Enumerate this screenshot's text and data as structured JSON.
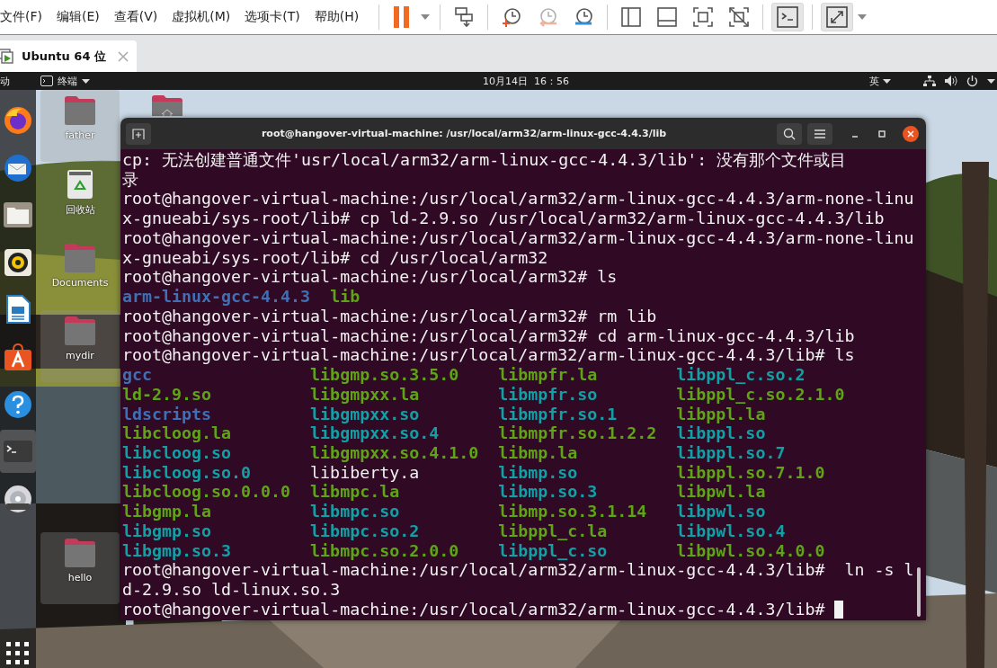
{
  "menubar": {
    "menus": [
      {
        "label": "文件(F)"
      },
      {
        "label": "编辑(E)"
      },
      {
        "label": "查看(V)"
      },
      {
        "label": "虚拟机(M)"
      },
      {
        "label": "选项卡(T)"
      },
      {
        "label": "帮助(H)"
      }
    ]
  },
  "toolbar": {
    "groups": [
      {
        "buttons": [
          {
            "kind": "pause",
            "disabled": false,
            "pressed": false
          },
          {
            "kind": "dropdown",
            "disabled": false,
            "pressed": false
          }
        ]
      },
      {
        "buttons": [
          {
            "kind": "send-keys",
            "disabled": false,
            "pressed": false
          }
        ]
      },
      {
        "buttons": [
          {
            "kind": "snapshot-take",
            "disabled": false,
            "pressed": false
          },
          {
            "kind": "snapshot-revert",
            "disabled": true,
            "pressed": false
          },
          {
            "kind": "snapshot-manage",
            "disabled": false,
            "pressed": false
          }
        ]
      },
      {
        "buttons": [
          {
            "kind": "view-library",
            "disabled": false,
            "pressed": false
          },
          {
            "kind": "view-thumbnails",
            "disabled": false,
            "pressed": false
          },
          {
            "kind": "view-fit",
            "disabled": false,
            "pressed": false
          },
          {
            "kind": "view-nofit",
            "disabled": false,
            "pressed": false
          }
        ]
      },
      {
        "buttons": [
          {
            "kind": "console",
            "disabled": false,
            "pressed": true
          }
        ]
      },
      {
        "buttons": [
          {
            "kind": "fullscreen",
            "disabled": false,
            "pressed": true
          },
          {
            "kind": "dropdown",
            "disabled": false,
            "pressed": false
          }
        ]
      }
    ]
  },
  "vm_tabs": [
    {
      "label": "Ubuntu 64 位",
      "selected": true
    }
  ],
  "top_bar": {
    "activities": "动",
    "app_menu": "终端",
    "clock": "10月14日  16：56",
    "input_method": "英"
  },
  "dock": {
    "items": [
      {
        "kind": "browser",
        "active": false
      },
      {
        "kind": "mail",
        "active": false
      },
      {
        "kind": "files",
        "active": false
      },
      {
        "kind": "music",
        "active": false
      },
      {
        "kind": "writer",
        "active": false
      },
      {
        "kind": "software",
        "active": false
      },
      {
        "kind": "help",
        "active": false
      },
      {
        "kind": "terminal",
        "active": true
      },
      {
        "kind": "disc",
        "active": false
      }
    ]
  },
  "desktop_icons": [
    {
      "kind": "folder",
      "label": "father",
      "selected": true
    },
    {
      "kind": "home-folder",
      "selected": false
    },
    {
      "kind": "trash",
      "label": "回收站",
      "selected": false
    },
    {
      "kind": "folder",
      "label": "Documents",
      "selected": false
    },
    {
      "kind": "folder",
      "label": "mydir",
      "selected": true
    },
    {
      "kind": "folder",
      "label": "hello",
      "selected": true
    }
  ],
  "terminal": {
    "title": "root@hangover-virtual-machine: /usr/local/arm32/arm-linux-gcc-4.4.3/lib",
    "lines": [
      {
        "kind": "text",
        "text": "cp: 无法创建普通文件'usr/local/arm32/arm-linux-gcc-4.4.3/lib': 没有那个文件或目"
      },
      {
        "kind": "text",
        "text": "录"
      },
      {
        "kind": "text",
        "text": "root@hangover-virtual-machine:/usr/local/arm32/arm-linux-gcc-4.4.3/arm-none-linu"
      },
      {
        "kind": "text",
        "text": "x-gnueabi/sys-root/lib# cp ld-2.9.so /usr/local/arm32/arm-linux-gcc-4.4.3/lib"
      },
      {
        "kind": "text",
        "text": "root@hangover-virtual-machine:/usr/local/arm32/arm-linux-gcc-4.4.3/arm-none-linu"
      },
      {
        "kind": "text",
        "text": "x-gnueabi/sys-root/lib# cd /usr/local/arm32"
      },
      {
        "kind": "text",
        "text": "root@hangover-virtual-machine:/usr/local/arm32# ls"
      },
      {
        "kind": "ls",
        "items": [
          {
            "name": "arm-linux-gcc-4.4.3",
            "kind": "dir"
          },
          {
            "name": "lib",
            "kind": "exec"
          }
        ]
      },
      {
        "kind": "text",
        "text": "root@hangover-virtual-machine:/usr/local/arm32# rm lib"
      },
      {
        "kind": "text",
        "text": "root@hangover-virtual-machine:/usr/local/arm32# cd arm-linux-gcc-4.4.3/lib"
      },
      {
        "kind": "text",
        "text": "root@hangover-virtual-machine:/usr/local/arm32/arm-linux-gcc-4.4.3/lib# ls"
      },
      {
        "kind": "ls-columns",
        "items": [
          {
            "name": "gcc",
            "kind": "dir"
          },
          {
            "name": "libgmp.so.3.5.0",
            "kind": "exec"
          },
          {
            "name": "libmpfr.la",
            "kind": "exec"
          },
          {
            "name": "libppl_c.so.2",
            "kind": "link"
          }
        ]
      },
      {
        "kind": "ls-columns",
        "items": [
          {
            "name": "ld-2.9.so",
            "kind": "exec"
          },
          {
            "name": "libgmpxx.la",
            "kind": "exec"
          },
          {
            "name": "libmpfr.so",
            "kind": "link"
          },
          {
            "name": "libppl_c.so.2.1.0",
            "kind": "exec"
          }
        ]
      },
      {
        "kind": "ls-columns",
        "items": [
          {
            "name": "ldscripts",
            "kind": "dir"
          },
          {
            "name": "libgmpxx.so",
            "kind": "link"
          },
          {
            "name": "libmpfr.so.1",
            "kind": "link"
          },
          {
            "name": "libppl.la",
            "kind": "exec"
          }
        ]
      },
      {
        "kind": "ls-columns",
        "items": [
          {
            "name": "libcloog.la",
            "kind": "exec"
          },
          {
            "name": "libgmpxx.so.4",
            "kind": "link"
          },
          {
            "name": "libmpfr.so.1.2.2",
            "kind": "exec"
          },
          {
            "name": "libppl.so",
            "kind": "link"
          }
        ]
      },
      {
        "kind": "ls-columns",
        "items": [
          {
            "name": "libcloog.so",
            "kind": "link"
          },
          {
            "name": "libgmpxx.so.4.1.0",
            "kind": "exec"
          },
          {
            "name": "libmp.la",
            "kind": "exec"
          },
          {
            "name": "libppl.so.7",
            "kind": "link"
          }
        ]
      },
      {
        "kind": "ls-columns",
        "items": [
          {
            "name": "libcloog.so.0",
            "kind": "link"
          },
          {
            "name": "libiberty.a",
            "kind": "file"
          },
          {
            "name": "libmp.so",
            "kind": "link"
          },
          {
            "name": "libppl.so.7.1.0",
            "kind": "exec"
          }
        ]
      },
      {
        "kind": "ls-columns",
        "items": [
          {
            "name": "libcloog.so.0.0.0",
            "kind": "exec"
          },
          {
            "name": "libmpc.la",
            "kind": "exec"
          },
          {
            "name": "libmp.so.3",
            "kind": "link"
          },
          {
            "name": "libpwl.la",
            "kind": "exec"
          }
        ]
      },
      {
        "kind": "ls-columns",
        "items": [
          {
            "name": "libgmp.la",
            "kind": "exec"
          },
          {
            "name": "libmpc.so",
            "kind": "link"
          },
          {
            "name": "libmp.so.3.1.14",
            "kind": "exec"
          },
          {
            "name": "libpwl.so",
            "kind": "link"
          }
        ]
      },
      {
        "kind": "ls-columns",
        "items": [
          {
            "name": "libgmp.so",
            "kind": "link"
          },
          {
            "name": "libmpc.so.2",
            "kind": "link"
          },
          {
            "name": "libppl_c.la",
            "kind": "exec"
          },
          {
            "name": "libpwl.so.4",
            "kind": "link"
          }
        ]
      },
      {
        "kind": "ls-columns",
        "items": [
          {
            "name": "libgmp.so.3",
            "kind": "link"
          },
          {
            "name": "libmpc.so.2.0.0",
            "kind": "exec"
          },
          {
            "name": "libppl_c.so",
            "kind": "link"
          },
          {
            "name": "libpwl.so.4.0.0",
            "kind": "exec"
          }
        ]
      },
      {
        "kind": "text",
        "text": "root@hangover-virtual-machine:/usr/local/arm32/arm-linux-gcc-4.4.3/lib#  ln -s l"
      },
      {
        "kind": "text",
        "text": "d-2.9.so ld-linux.so.3"
      },
      {
        "kind": "prompt",
        "text": "root@hangover-virtual-machine:/usr/local/arm32/arm-linux-gcc-4.4.3/lib#",
        "cursor": true
      }
    ]
  }
}
